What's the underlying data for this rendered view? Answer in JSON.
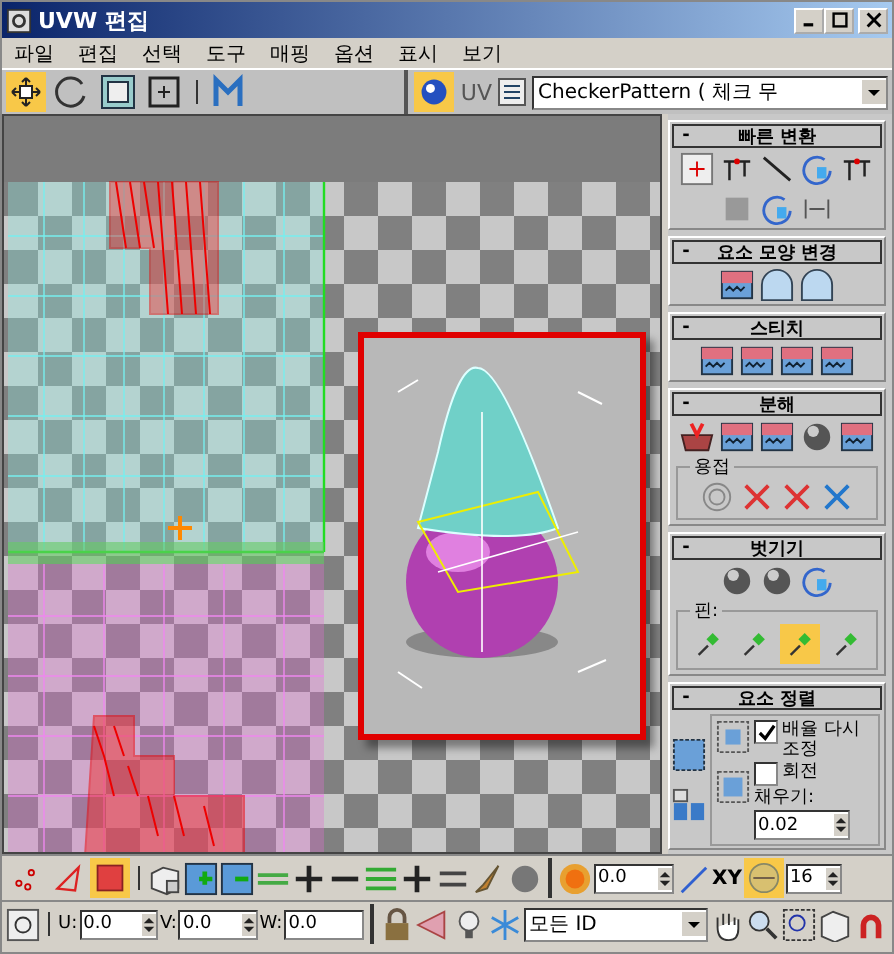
{
  "window": {
    "title": "UVW 편집"
  },
  "menu": [
    "파일",
    "편집",
    "선택",
    "도구",
    "매핑",
    "옵션",
    "표시",
    "보기"
  ],
  "toolbar": {
    "tools": [
      {
        "selected": true
      },
      {
        "selected": false
      },
      {
        "selected": false
      },
      {
        "selected": false
      },
      {
        "selected": false
      }
    ],
    "map_button": {
      "selected": true
    },
    "uv_label": "UV",
    "texture_dropdown": "CheckerPattern ( 체크 무"
  },
  "rollouts": [
    {
      "sign": "-",
      "title": "빠른 변환"
    },
    {
      "sign": "-",
      "title": "요소 모양 변경"
    },
    {
      "sign": "-",
      "title": "스티치"
    },
    {
      "sign": "-",
      "title": "분해",
      "group": {
        "title": "용접"
      }
    },
    {
      "sign": "-",
      "title": "벗기기",
      "group": {
        "title": "핀:",
        "tools": [
          {
            "selected": false
          },
          {
            "selected": false
          },
          {
            "selected": true
          },
          {
            "selected": false
          }
        ]
      }
    },
    {
      "sign": "-",
      "title": "요소 정렬",
      "options": [
        {
          "label": "배율 다시 조정",
          "checked": true
        },
        {
          "label": "회전",
          "checked": false
        }
      ],
      "fill": {
        "label": "채우기:",
        "value": "0.02"
      }
    }
  ],
  "bottom_toolbar": {
    "subobject_modes": [
      {
        "selected": false
      },
      {
        "selected": false
      },
      {
        "selected": true
      }
    ],
    "soft_select_value": "0.0",
    "axis_label": "XY",
    "snap": {
      "selected": true
    },
    "snap_value": "16"
  },
  "status_row": {
    "coords": [
      {
        "label": "U:",
        "value": "0.0"
      },
      {
        "label": "V:",
        "value": "0.0"
      },
      {
        "label": "W:",
        "value": "0.0"
      }
    ],
    "id_filter": "모든 ID"
  }
}
